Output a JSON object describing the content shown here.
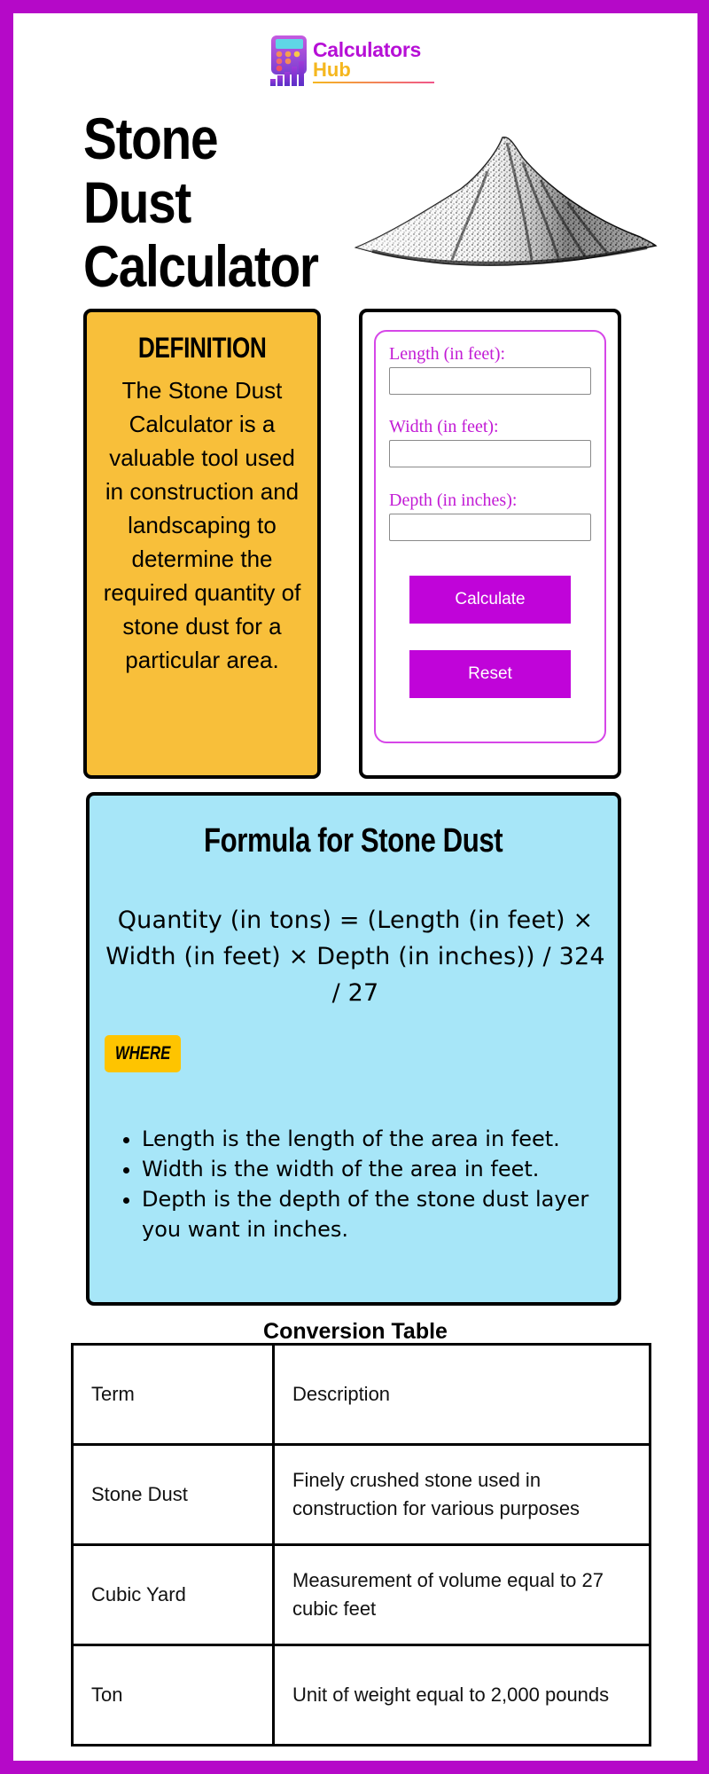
{
  "brand": {
    "line1": "Calculators",
    "line2": "Hub",
    "icon": "calculator-chart-logo-icon",
    "colors": {
      "primary": "#b60fd6",
      "secondary": "#f5b71f"
    }
  },
  "page": {
    "frame_color": "#b509c8",
    "title_lines": [
      "Stone",
      "Dust",
      "Calculator"
    ],
    "illustration": "stone-dust-pile-image"
  },
  "definition": {
    "heading": "DEFINITION",
    "body": "The Stone Dust Calculator is a valuable tool used in construction and landscaping to determine the required quantity of stone dust for a particular area.",
    "bg_color": "#f8bf3a"
  },
  "calculator": {
    "fields": [
      {
        "label": "Length (in feet):",
        "value": "",
        "placeholder": ""
      },
      {
        "label": "Width (in feet):",
        "value": "",
        "placeholder": ""
      },
      {
        "label": "Depth (in inches):",
        "value": "",
        "placeholder": ""
      }
    ],
    "calculate_label": "Calculate",
    "reset_label": "Reset",
    "accent_color": "#c004d9"
  },
  "formula": {
    "heading": "Formula for Stone Dust",
    "expression": "Quantity (in tons) = (Length (in feet) × Width (in feet) × Depth (in inches)) / 324 / 27",
    "where_label": "WHERE",
    "variables": [
      "Length is the length of the area in feet.",
      "Width is the width of the area in feet.",
      "Depth is the depth of the stone dust layer you want in inches."
    ],
    "bg_color": "#a7e6f8"
  },
  "conversion_table": {
    "title": "Conversion Table",
    "headers": [
      "Term",
      "Description"
    ],
    "rows": [
      [
        "Stone Dust",
        "Finely crushed stone used in construction for various purposes"
      ],
      [
        "Cubic Yard",
        "Measurement of volume equal to 27 cubic feet"
      ],
      [
        "Ton",
        "Unit of weight equal to 2,000 pounds"
      ]
    ]
  }
}
